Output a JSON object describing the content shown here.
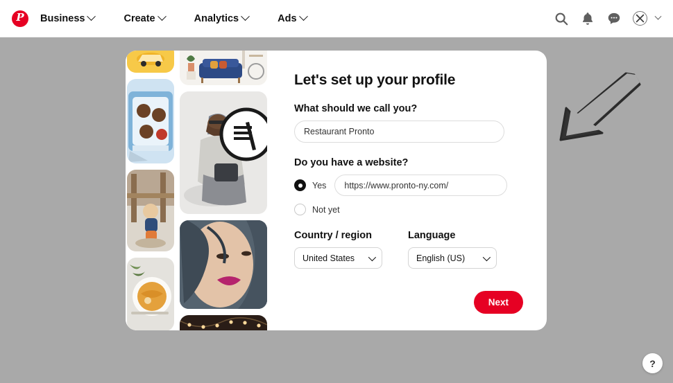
{
  "header": {
    "logo_icon": "pinterest-logo-icon",
    "logo_glyph": "P",
    "nav": [
      {
        "label": "Business",
        "icon": "chevron-down-icon"
      },
      {
        "label": "Create",
        "icon": "chevron-down-icon"
      },
      {
        "label": "Analytics",
        "icon": "chevron-down-icon"
      },
      {
        "label": "Ads",
        "icon": "chevron-down-icon"
      }
    ],
    "actions": [
      {
        "icon": "search-icon"
      },
      {
        "icon": "bell-icon"
      },
      {
        "icon": "message-bubble-icon"
      },
      {
        "icon": "avatar-icon"
      },
      {
        "icon": "chevron-down-icon"
      }
    ]
  },
  "card": {
    "title": "Let's set up your profile",
    "name_field": {
      "label": "What should we call you?",
      "value": "Restaurant Pronto",
      "placeholder": "Restaurant Pronto"
    },
    "website_field": {
      "label": "Do you have a website?",
      "options": [
        {
          "label": "Yes",
          "selected": true
        },
        {
          "label": "Not yet",
          "selected": false
        }
      ],
      "url_value": "https://www.pronto-ny.com/",
      "url_placeholder": "https://"
    },
    "country_field": {
      "label": "Country / region",
      "value": "United States",
      "icon": "chevron-down-icon"
    },
    "language_field": {
      "label": "Language",
      "value": "English (US)",
      "icon": "chevron-down-icon"
    },
    "next_button": "Next"
  },
  "annotation": {
    "arrow_icon": "hand-drawn-arrow-down-left-icon"
  },
  "help": {
    "label": "?",
    "icon": "help-question-icon"
  },
  "colors": {
    "brand_red": "#e60023",
    "overlay_gray": "#a9a9a9",
    "text_primary": "#111111",
    "border_gray": "#dcdcdc"
  }
}
